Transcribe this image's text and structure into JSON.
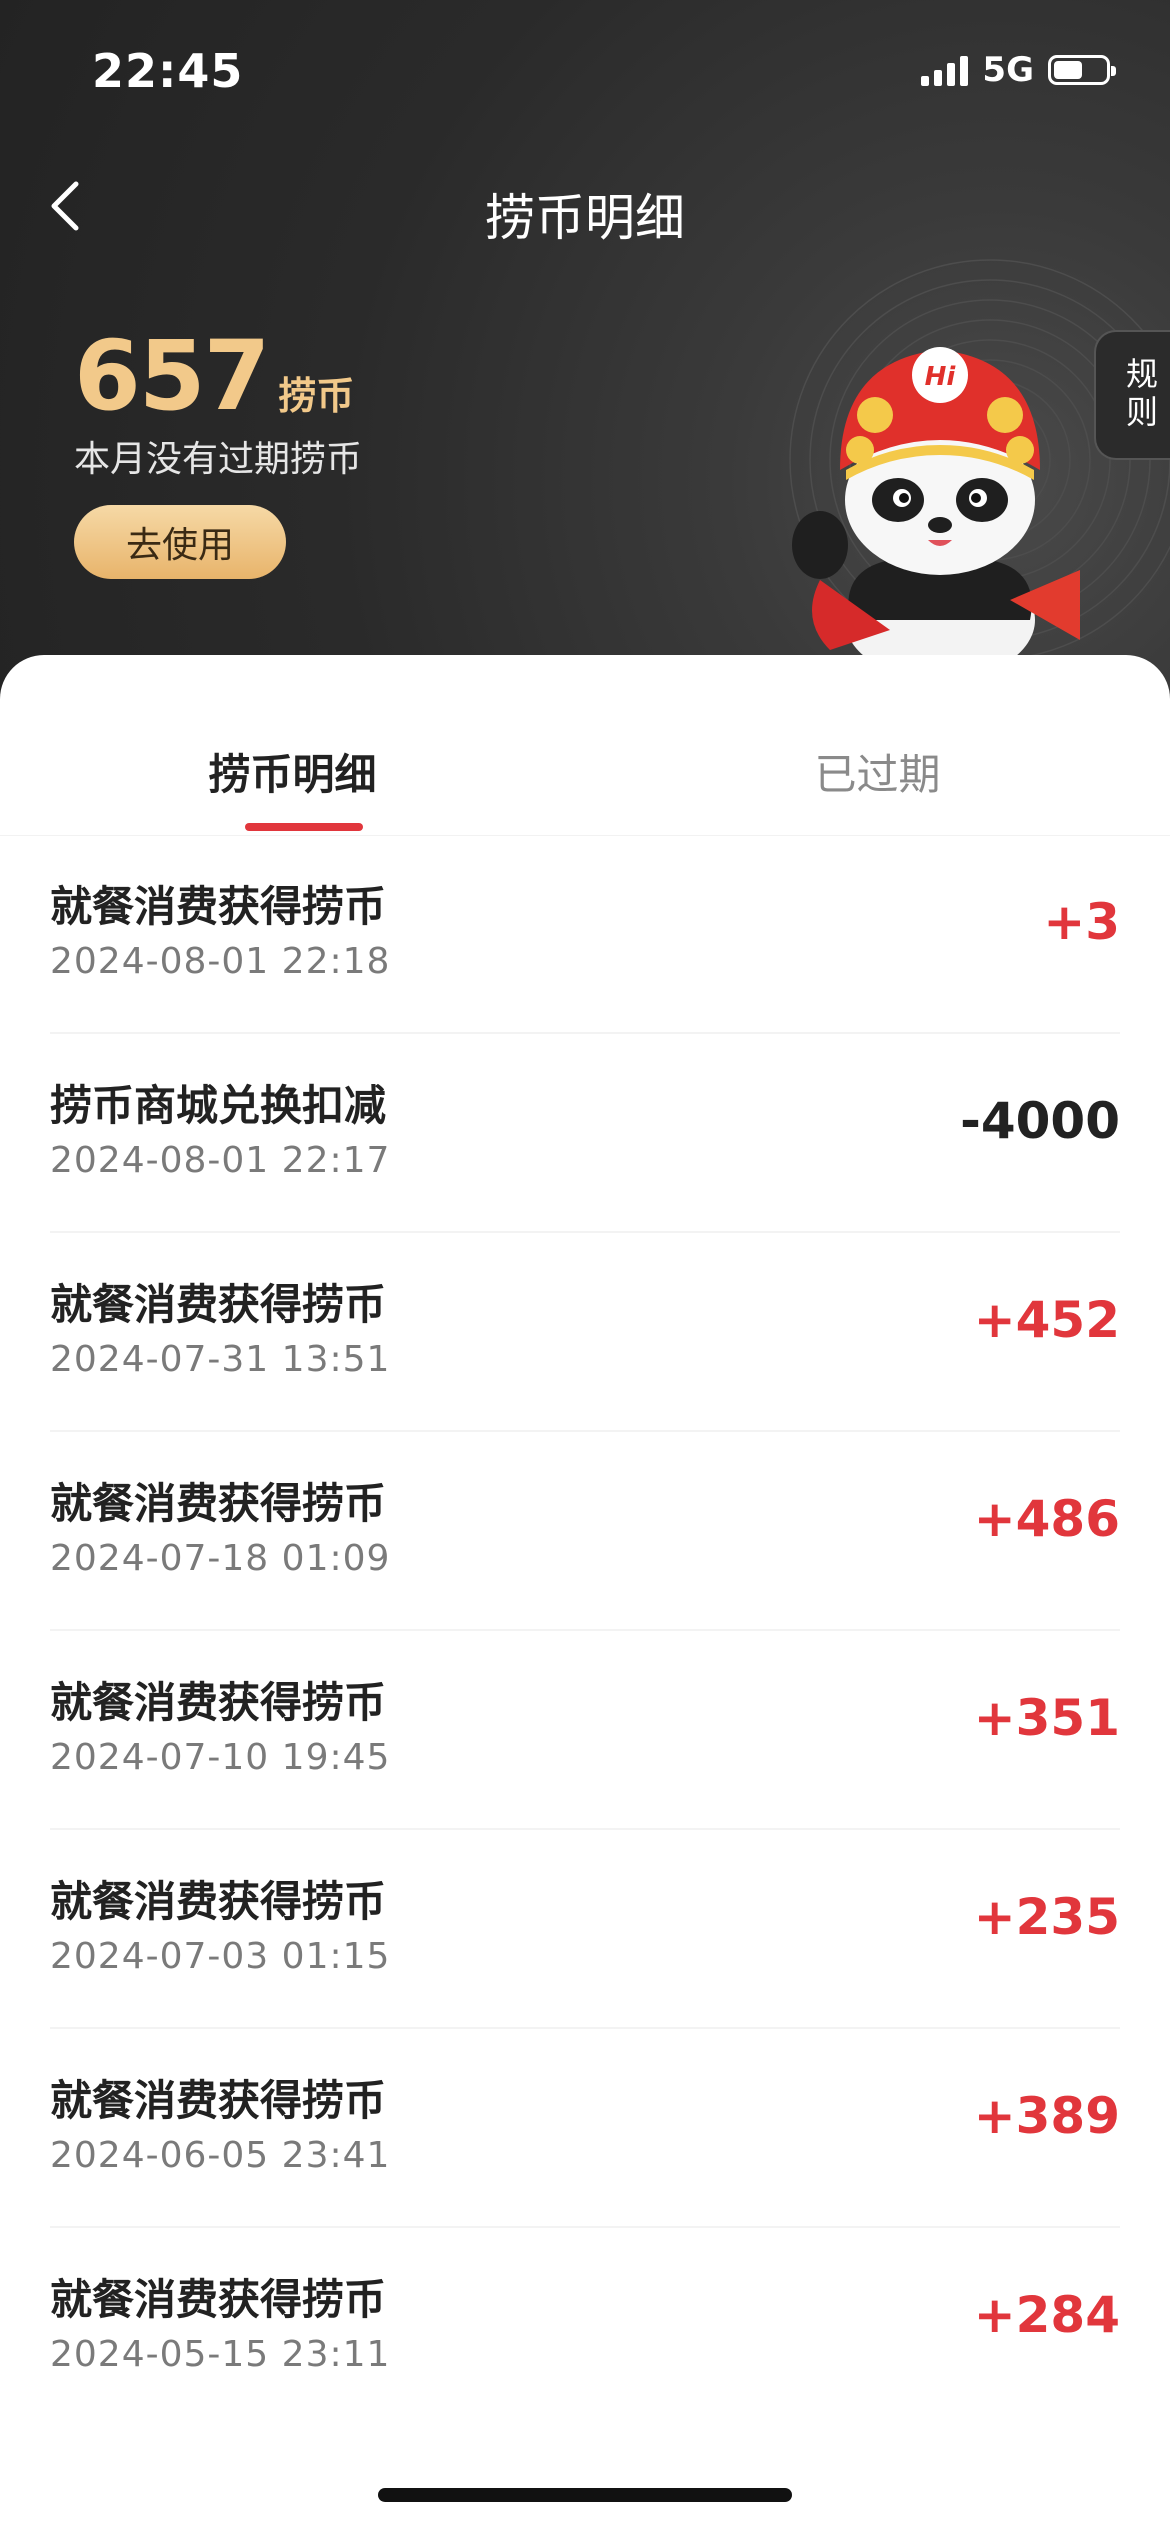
{
  "status_bar": {
    "time": "22:45",
    "network": "5G",
    "battery_fraction": 0.55
  },
  "nav": {
    "title": "捞币明细"
  },
  "balance": {
    "value": "657",
    "unit": "捞币",
    "expire_note": "本月没有过期捞币",
    "use_label": "去使用"
  },
  "rules_label": "规则",
  "tabs": [
    {
      "label": "捞币明细",
      "active": true
    },
    {
      "label": "已过期",
      "active": false
    }
  ],
  "transactions": [
    {
      "title": "就餐消费获得捞币",
      "time": "2024-08-01 22:18",
      "amount": "+3"
    },
    {
      "title": "捞币商城兑换扣减",
      "time": "2024-08-01 22:17",
      "amount": "-4000"
    },
    {
      "title": "就餐消费获得捞币",
      "time": "2024-07-31 13:51",
      "amount": "+452"
    },
    {
      "title": "就餐消费获得捞币",
      "time": "2024-07-18 01:09",
      "amount": "+486"
    },
    {
      "title": "就餐消费获得捞币",
      "time": "2024-07-10 19:45",
      "amount": "+351"
    },
    {
      "title": "就餐消费获得捞币",
      "time": "2024-07-03 01:15",
      "amount": "+235"
    },
    {
      "title": "就餐消费获得捞币",
      "time": "2024-06-05 23:41",
      "amount": "+389"
    },
    {
      "title": "就餐消费获得捞币",
      "time": "2024-05-15 23:11",
      "amount": "+284"
    }
  ],
  "mascot_badge": "Hi",
  "colors": {
    "accent_red": "#e1363c",
    "gold": "#f2c98a",
    "header_bg": "#2a2a2a"
  }
}
